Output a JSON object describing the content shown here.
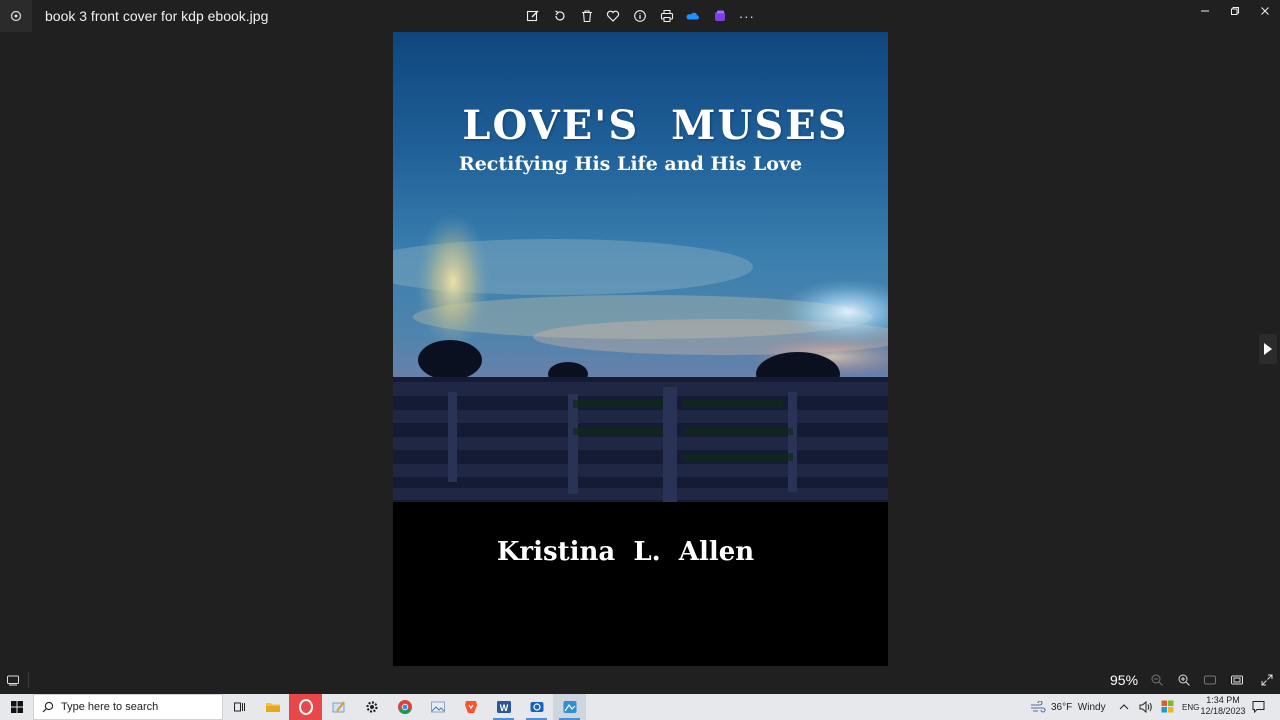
{
  "window": {
    "file_name": "book 3 front cover for kdp ebook.jpg"
  },
  "toolbar": {
    "buttons": [
      "edit-icon",
      "rotate-icon",
      "delete-icon",
      "favorite-icon",
      "info-icon",
      "print-icon",
      "onedrive-icon",
      "clipchamp-icon",
      "more-icon"
    ],
    "more_label": "···"
  },
  "cover": {
    "title": "LOVE'S  MUSES",
    "subtitle": "Rectifying His Life and His Love",
    "author": "Kristina  L.  Allen"
  },
  "statusbar": {
    "zoom": "95%"
  },
  "taskbar": {
    "search_placeholder": "Type here to search",
    "apps": [
      "task-view",
      "file-explorer",
      "opera",
      "paint",
      "settings",
      "chrome",
      "photos-viewer",
      "brave",
      "word",
      "camera",
      "photos"
    ],
    "weather": "36°F  Windy",
    "language": "ENG",
    "time": "1:34 PM",
    "date": "12/18/2023"
  }
}
